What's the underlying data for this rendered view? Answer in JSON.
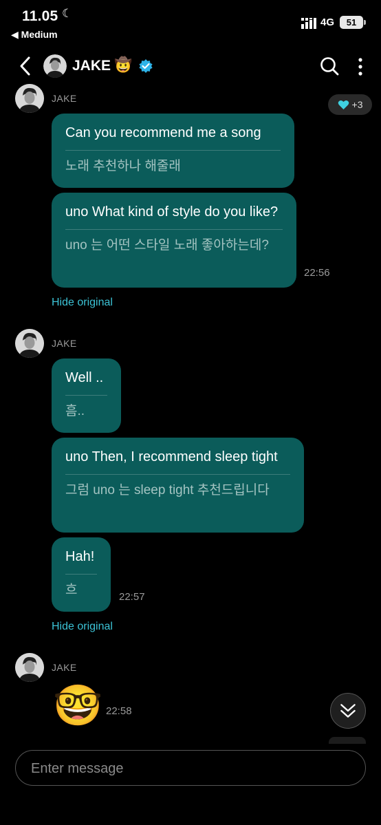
{
  "status_bar": {
    "time": "11.05",
    "back_app": "◀ Medium",
    "network": "4G",
    "battery": "51"
  },
  "header": {
    "name": "JAKE",
    "emoji": "🤠"
  },
  "reaction": {
    "count": "+3"
  },
  "groups": [
    {
      "sender": "JAKE",
      "messages": [
        {
          "text": "Can you recommend me a song",
          "translation": "노래 추천하나 해줄래"
        },
        {
          "text": "uno What kind of style do you like?",
          "translation": "uno 는 어떤 스타일 노래 좋아하는데?",
          "time": "22:56"
        }
      ],
      "toggle": "Hide original"
    },
    {
      "sender": "JAKE",
      "messages": [
        {
          "text": "Well ..",
          "translation": "흠.."
        },
        {
          "text": "uno Then, I recommend sleep tight",
          "translation": "그럼 uno 는 sleep tight 추천드립니다"
        },
        {
          "text": "Hah!",
          "translation": "흐",
          "time": "22:57"
        }
      ],
      "toggle": "Hide original"
    },
    {
      "sender": "JAKE",
      "emoji": "🤓",
      "time": "22:58"
    }
  ],
  "composer": {
    "placeholder": "Enter message"
  },
  "colors": {
    "bubble": "#0b5c5a",
    "accent": "#3cc3d6",
    "verified": "#2eb3e8"
  }
}
